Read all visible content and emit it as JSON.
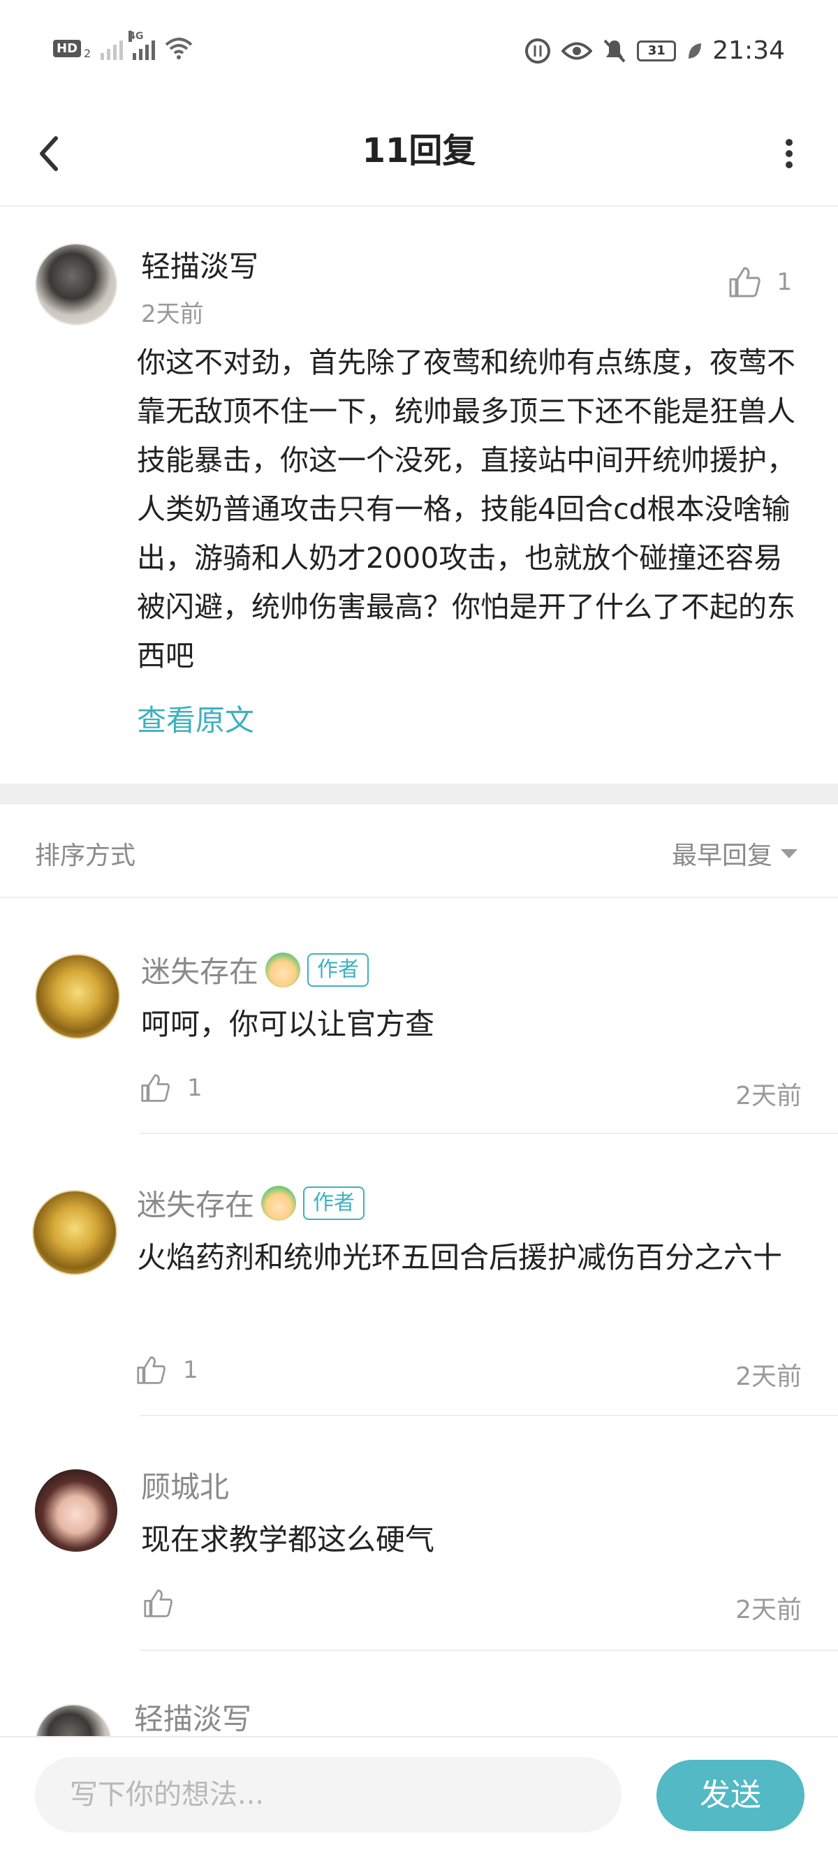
{
  "status_bar": {
    "left": {
      "hd": "HD",
      "hd_sub": "2",
      "network": "4G"
    },
    "right": {
      "battery": "31",
      "time": "21:34"
    }
  },
  "nav": {
    "title": "11回复",
    "icons": {
      "back": "back-arrow-icon",
      "more": "more-vertical-icon"
    }
  },
  "original_comment": {
    "username": "轻描淡写",
    "time": "2天前",
    "likes": "1",
    "text": "你这不对劲，首先除了夜莺和统帅有点练度，夜莺不靠无敌顶不住一下，统帅最多顶三下还不能是狂兽人技能暴击，你这一个没死，直接站中间开统帅援护，人类奶普通攻击只有一格，技能4回合cd根本没啥输出，游骑和人奶才2000攻击，也就放个碰撞还容易被闪避，统帅伤害最高？你怕是开了什么了不起的东西吧",
    "view_original": "查看原文"
  },
  "sort": {
    "label": "排序方式",
    "value": "最早回复"
  },
  "replies": [
    {
      "username": "迷失存在",
      "badge": "作者",
      "text": "呵呵，你可以让官方查",
      "likes": "1",
      "time": "2天前"
    },
    {
      "username": "迷失存在",
      "badge": "作者",
      "text": "火焰药剂和统帅光环五回合后援护减伤百分之六十",
      "likes": "1",
      "time": "2天前"
    },
    {
      "username": "顾城北",
      "text": "现在求教学都这么硬气",
      "likes": "",
      "time": "2天前"
    },
    {
      "username": "轻描淡写"
    }
  ],
  "input": {
    "placeholder": "写下你的想法...",
    "send": "发送"
  },
  "colors": {
    "accent": "#3eb1bf",
    "send_button": "#52b9c5",
    "separator": "#efefef"
  }
}
